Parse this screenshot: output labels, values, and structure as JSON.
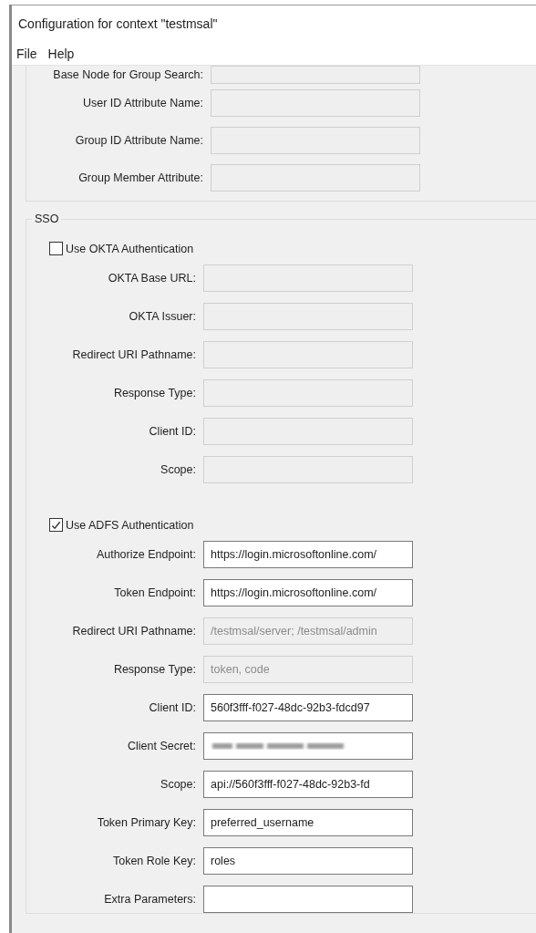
{
  "window": {
    "title": "Configuration for context \"testmsal\""
  },
  "menu": [
    {
      "label": "File"
    },
    {
      "label": "Help"
    }
  ],
  "ldap_fields": [
    {
      "label": "Base Node for Group Search:",
      "disabled": true
    },
    {
      "label": "User ID Attribute Name:",
      "disabled": true
    },
    {
      "label": "Group ID Attribute Name:",
      "disabled": true
    },
    {
      "label": "Group Member Attribute:",
      "disabled": true
    }
  ],
  "sso": {
    "title": "SSO",
    "okta": {
      "label": "Use OKTA Authentication",
      "checked": false,
      "fields": [
        {
          "label": "OKTA Base URL:",
          "disabled": true
        },
        {
          "label": "OKTA Issuer:",
          "disabled": true
        },
        {
          "label": "Redirect URI Pathname:",
          "disabled": true
        },
        {
          "label": "Response Type:",
          "disabled": true
        },
        {
          "label": "Client ID:",
          "disabled": true
        },
        {
          "label": "Scope:",
          "disabled": true
        }
      ]
    },
    "adfs": {
      "label": "Use ADFS Authentication",
      "checked": true,
      "fields": [
        {
          "label": "Authorize Endpoint:",
          "value": "https://login.microsoftonline.com/",
          "disabled": false,
          "obscured": false
        },
        {
          "label": "Token Endpoint:",
          "value": "https://login.microsoftonline.com/",
          "disabled": false,
          "obscured": false
        },
        {
          "label": "Redirect URI Pathname:",
          "value": "/testmsal/server; /testmsal/admin",
          "disabled": true,
          "obscured": false
        },
        {
          "label": "Response Type:",
          "value": "token, code",
          "disabled": true,
          "obscured": false
        },
        {
          "label": "Client ID:",
          "value": "560f3fff-f027-48dc-92b3-fdcd97",
          "disabled": false,
          "obscured": false
        },
        {
          "label": "Client Secret:",
          "disabled": false,
          "obscured": true
        },
        {
          "label": "Scope:",
          "value": "api://560f3fff-f027-48dc-92b3-fd",
          "disabled": false,
          "obscured": false
        },
        {
          "label": "Token Primary Key:",
          "value": "preferred_username",
          "disabled": false,
          "obscured": false
        },
        {
          "label": "Token Role Key:",
          "value": "roles",
          "disabled": false,
          "obscured": false
        },
        {
          "label": "Extra Parameters:",
          "disabled": false,
          "obscured": false
        }
      ]
    }
  }
}
